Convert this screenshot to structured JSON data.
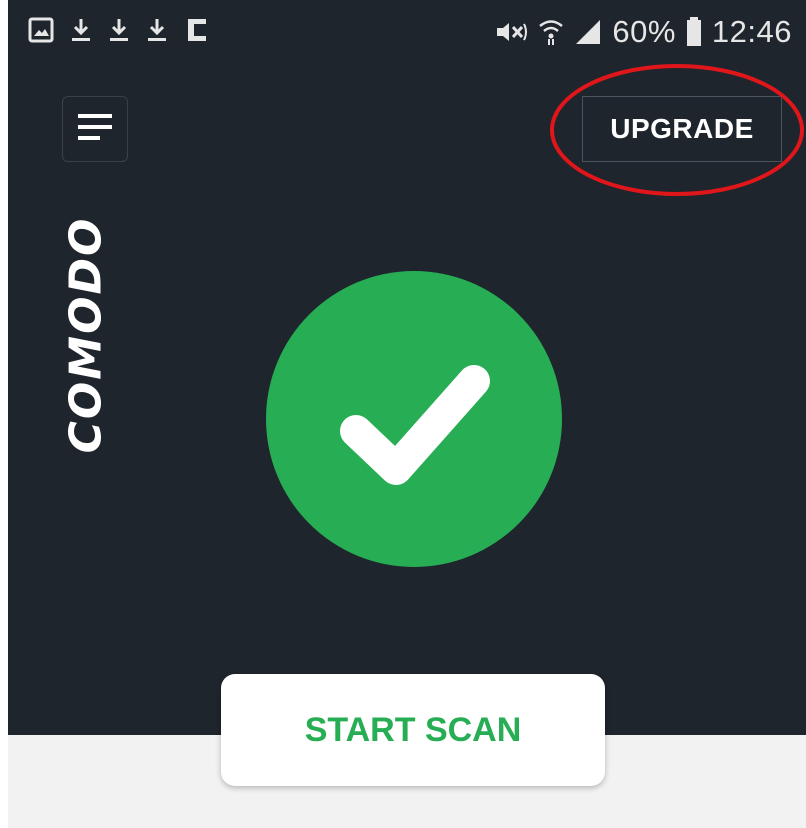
{
  "status_bar": {
    "left_icons": [
      "gallery-icon",
      "download-icon",
      "download-icon",
      "download-icon",
      "c-icon"
    ],
    "right_icons": [
      "mute-icon",
      "wifi-icon",
      "signal-icon",
      "battery-icon"
    ],
    "battery_percent": "60%",
    "time": "12:46"
  },
  "header": {
    "menu_icon": "hamburger-menu-icon",
    "upgrade_label": "UPGRADE"
  },
  "brand": {
    "logo_text": "COMODO"
  },
  "status": {
    "icon": "check-icon",
    "color": "#27ae54"
  },
  "actions": {
    "scan_label": "START SCAN"
  },
  "colors": {
    "background": "#1f252c",
    "accent": "#27ae54",
    "highlight": "#e0161b"
  }
}
